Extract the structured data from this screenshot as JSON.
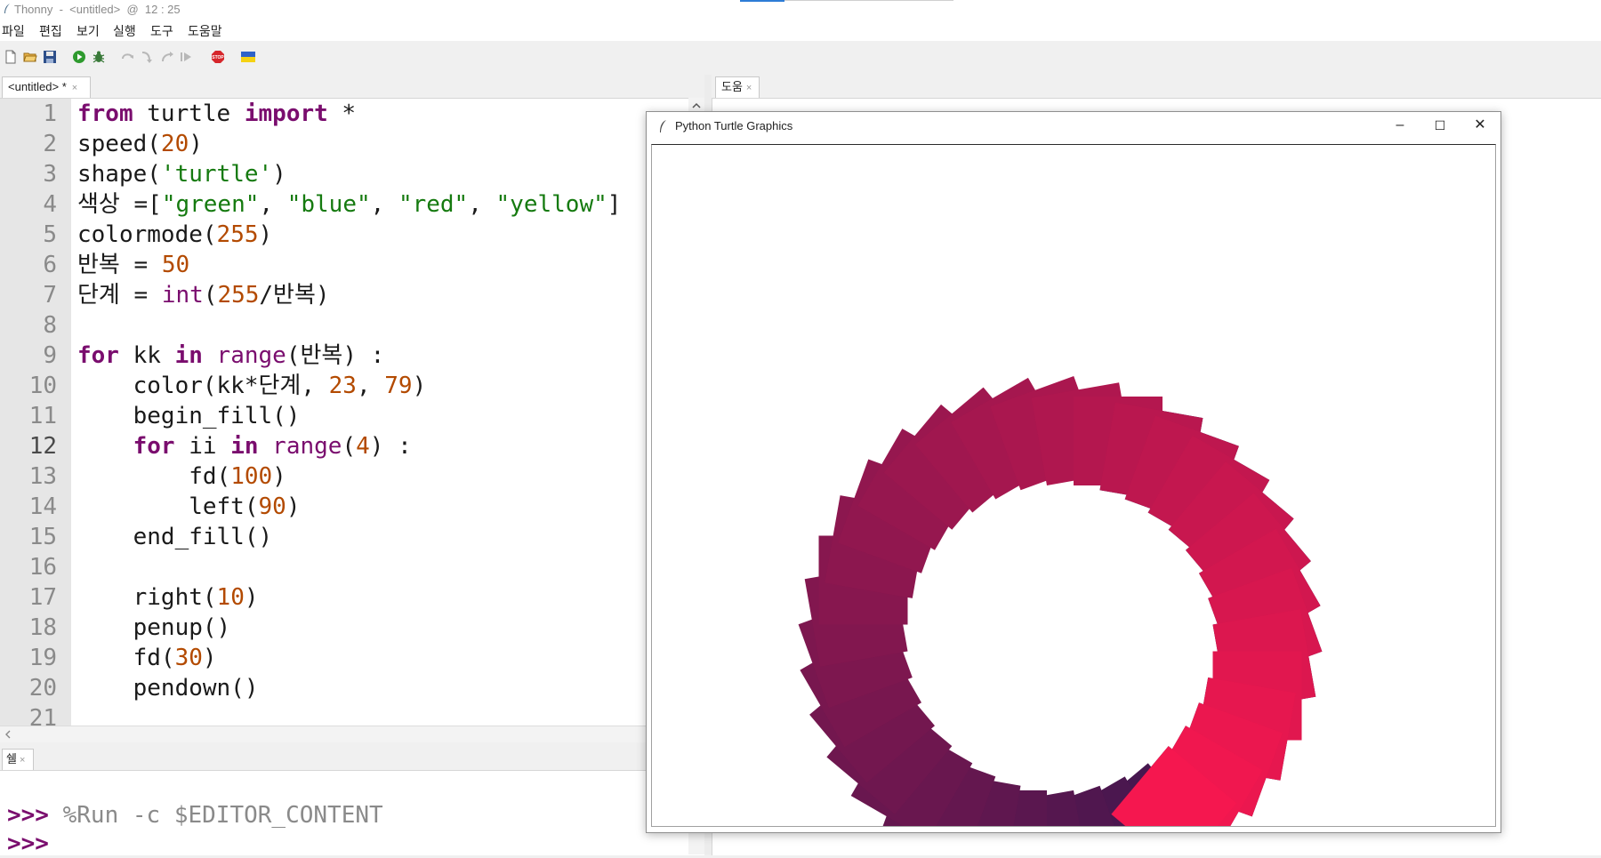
{
  "window": {
    "app_name": "Thonny",
    "title_full": "Thonny  -  <untitled>  @  12 : 25"
  },
  "menu": {
    "items": [
      "파일",
      "편집",
      "보기",
      "실행",
      "도구",
      "도움말"
    ]
  },
  "toolbar": {
    "buttons": [
      {
        "name": "new-file-icon"
      },
      {
        "name": "open-file-icon"
      },
      {
        "name": "save-file-icon"
      },
      {
        "name": "run-icon"
      },
      {
        "name": "debug-icon"
      },
      {
        "name": "step-over-icon"
      },
      {
        "name": "step-into-icon"
      },
      {
        "name": "step-out-icon"
      },
      {
        "name": "resume-icon"
      },
      {
        "name": "stop-icon",
        "label": "STOP"
      },
      {
        "name": "ukraine-flag-icon"
      }
    ]
  },
  "editor": {
    "tab_label": "<untitled> *",
    "tab_close": "×",
    "line_numbers": [
      "1",
      "2",
      "3",
      "4",
      "5",
      "6",
      "7",
      "8",
      "9",
      "10",
      "11",
      "12",
      "13",
      "14",
      "15",
      "16",
      "17",
      "18",
      "19",
      "20",
      "21"
    ],
    "current_line": "12"
  },
  "shell": {
    "tab_label": "쉘",
    "tab_close": "×",
    "line1_prompt": ">>>",
    "line1_cmd": " %Run -c $EDITOR_CONTENT",
    "line2_prompt": ">>>"
  },
  "help": {
    "tab_label": "도움",
    "tab_close": "×"
  },
  "turtle_window": {
    "title": "Python Turtle Graphics",
    "minimize": "–",
    "maximize": "☐",
    "close": "✕"
  },
  "colors": {
    "keyword": "#7a0d6e",
    "number": "#b34a00",
    "string": "#157a0f",
    "square_green": 23,
    "square_blue": 79
  }
}
